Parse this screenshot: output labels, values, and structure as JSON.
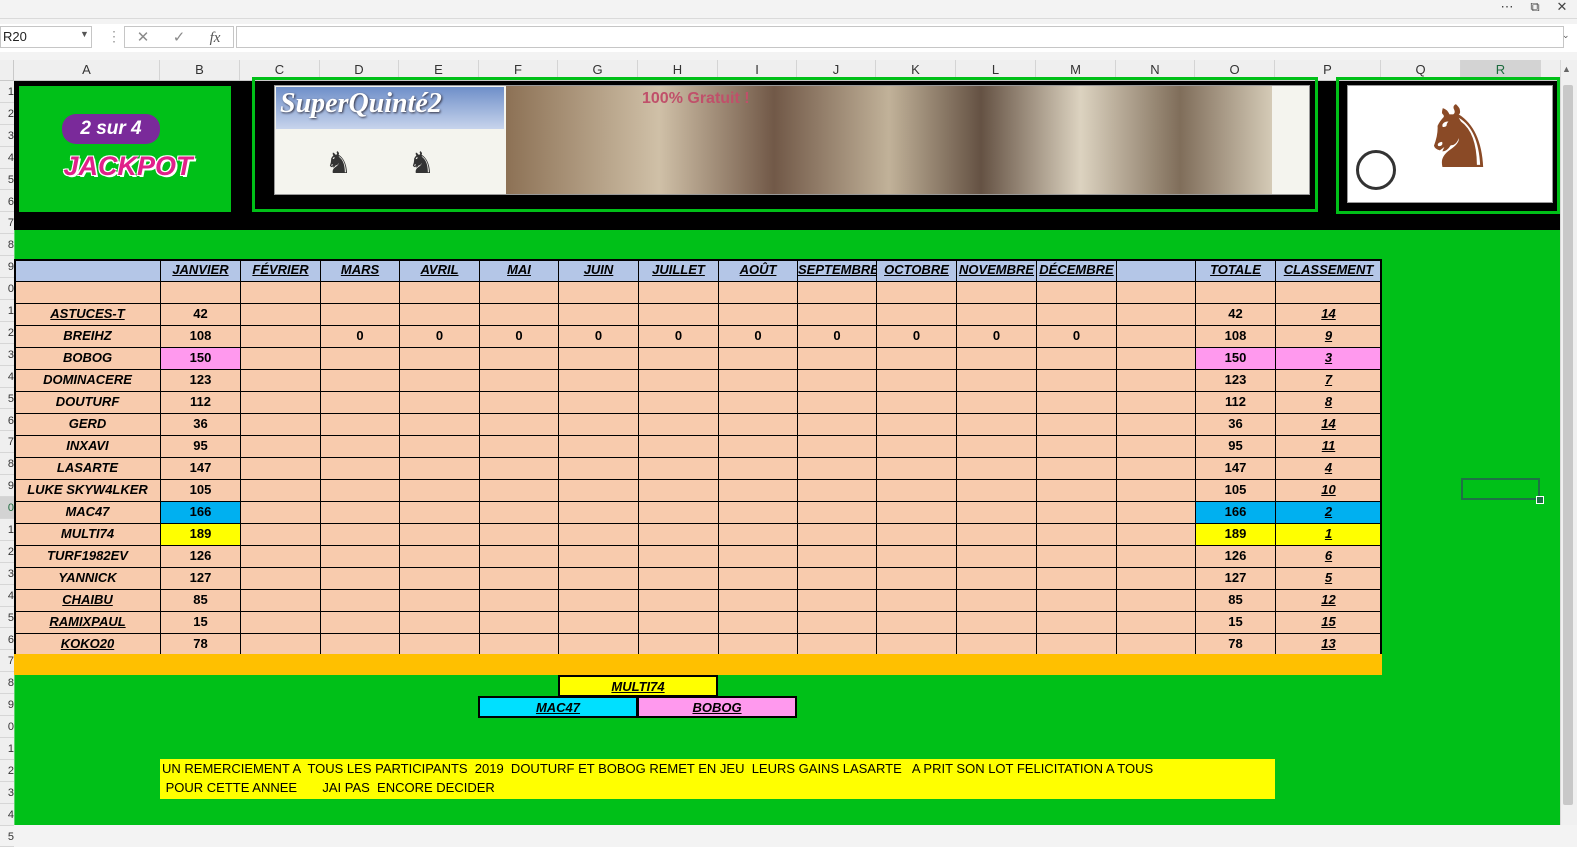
{
  "formula_bar": {
    "name_box": "R20",
    "cancel_icon": "✕",
    "enter_icon": "✓",
    "fx_label": "fx",
    "formula": ""
  },
  "columns": [
    "A",
    "B",
    "C",
    "D",
    "E",
    "F",
    "G",
    "H",
    "I",
    "J",
    "K",
    "L",
    "M",
    "N",
    "O",
    "P",
    "Q",
    "R"
  ],
  "selected_column": "R",
  "rows": [
    "1",
    "2",
    "3",
    "4",
    "5",
    "6",
    "7",
    "8",
    "9",
    "0",
    "1",
    "2",
    "3",
    "4",
    "5",
    "6",
    "7",
    "8",
    "9",
    "0",
    "1",
    "2",
    "3",
    "4",
    "5",
    "6",
    "7",
    "8",
    "9",
    "0",
    "1",
    "2",
    "3",
    "4",
    "5"
  ],
  "banner": {
    "logo_line1": "2 sur 4",
    "logo_line2": "JACKPOT",
    "title": "SuperQuinté2",
    "subtitle": "100% Gratuit !",
    "colors": {
      "frame": "#000000",
      "grid_green": "#00c018",
      "logo_purple": "#7a2a9a",
      "logo_pink": "#e0218a"
    }
  },
  "table": {
    "headers": [
      "",
      "JANVIER",
      "FÉVRIER",
      "MARS",
      "AVRIL",
      "MAI",
      "JUIN",
      "JUILLET",
      "AOÛT",
      "SEPTEMBRE",
      "OCTOBRE",
      "NOVEMBRE",
      "DÉCEMBRE",
      "",
      "TOTALE",
      "CLASSEMENT"
    ],
    "players": [
      {
        "name": "ASTUCES-T",
        "jan": "42",
        "months": [
          "",
          "",
          "",
          "",
          "",
          "",
          "",
          "",
          "",
          "",
          ""
        ],
        "total": "42",
        "rank": "14",
        "link": true
      },
      {
        "name": "BREIHZ",
        "jan": "108",
        "months": [
          "",
          "0",
          "0",
          "0",
          "0",
          "0",
          "0",
          "0",
          "0",
          "0",
          "0"
        ],
        "total": "108",
        "rank": "9",
        "link": false
      },
      {
        "name": "BOBOG",
        "jan": "150",
        "months": [
          "",
          "",
          "",
          "",
          "",
          "",
          "",
          "",
          "",
          "",
          ""
        ],
        "total": "150",
        "rank": "3",
        "link": false,
        "hl": "pink"
      },
      {
        "name": "DOMINACERE",
        "jan": "123",
        "months": [
          "",
          "",
          "",
          "",
          "",
          "",
          "",
          "",
          "",
          "",
          ""
        ],
        "total": "123",
        "rank": "7",
        "link": false
      },
      {
        "name": "DOUTURF",
        "jan": "112",
        "months": [
          "",
          "",
          "",
          "",
          "",
          "",
          "",
          "",
          "",
          "",
          ""
        ],
        "total": "112",
        "rank": "8",
        "link": false
      },
      {
        "name": "GERD",
        "jan": "36",
        "months": [
          "",
          "",
          "",
          "",
          "",
          "",
          "",
          "",
          "",
          "",
          ""
        ],
        "total": "36",
        "rank": "14",
        "link": false
      },
      {
        "name": "INXAVI",
        "jan": "95",
        "months": [
          "",
          "",
          "",
          "",
          "",
          "",
          "",
          "",
          "",
          "",
          ""
        ],
        "total": "95",
        "rank": "11",
        "link": false
      },
      {
        "name": "LASARTE",
        "jan": "147",
        "months": [
          "",
          "",
          "",
          "",
          "",
          "",
          "",
          "",
          "",
          "",
          ""
        ],
        "total": "147",
        "rank": "4",
        "link": false
      },
      {
        "name": "LUKE SKYW4LKER",
        "jan": "105",
        "months": [
          "",
          "",
          "",
          "",
          "",
          "",
          "",
          "",
          "",
          "",
          ""
        ],
        "total": "105",
        "rank": "10",
        "link": false
      },
      {
        "name": "MAC47",
        "jan": "166",
        "months": [
          "",
          "",
          "",
          "",
          "",
          "",
          "",
          "",
          "",
          "",
          ""
        ],
        "total": "166",
        "rank": "2",
        "link": false,
        "hl": "blue"
      },
      {
        "name": "MULTI74",
        "jan": "189",
        "months": [
          "",
          "",
          "",
          "",
          "",
          "",
          "",
          "",
          "",
          "",
          ""
        ],
        "total": "189",
        "rank": "1",
        "link": false,
        "hl": "yel"
      },
      {
        "name": "TURF1982EV",
        "jan": "126",
        "months": [
          "",
          "",
          "",
          "",
          "",
          "",
          "",
          "",
          "",
          "",
          ""
        ],
        "total": "126",
        "rank": "6",
        "link": false
      },
      {
        "name": "YANNICK",
        "jan": "127",
        "months": [
          "",
          "",
          "",
          "",
          "",
          "",
          "",
          "",
          "",
          "",
          ""
        ],
        "total": "127",
        "rank": "5",
        "link": false
      },
      {
        "name": "CHAIBU",
        "jan": "85",
        "months": [
          "",
          "",
          "",
          "",
          "",
          "",
          "",
          "",
          "",
          "",
          ""
        ],
        "total": "85",
        "rank": "12",
        "link": true
      },
      {
        "name": "RAMIXPAUL",
        "jan": "15",
        "months": [
          "",
          "",
          "",
          "",
          "",
          "",
          "",
          "",
          "",
          "",
          ""
        ],
        "total": "15",
        "rank": "15",
        "link": true
      },
      {
        "name": "KOKO20",
        "jan": "78",
        "months": [
          "",
          "",
          "",
          "",
          "",
          "",
          "",
          "",
          "",
          "",
          ""
        ],
        "total": "78",
        "rank": "13",
        "link": true
      }
    ]
  },
  "podium": {
    "first": "MULTI74",
    "second": "MAC47",
    "third": "BOBOG"
  },
  "message": {
    "line1": "UN REMERCIEMENT A  TOUS LES PARTICIPANTS  2019  DOUTURF ET BOBOG REMET EN JEU  LEURS GAINS LASARTE   A PRIT SON LOT FELICITATION A TOUS",
    "line2": " POUR CETTE ANNEE       JAI PAS  ENCORE DECIDER"
  }
}
